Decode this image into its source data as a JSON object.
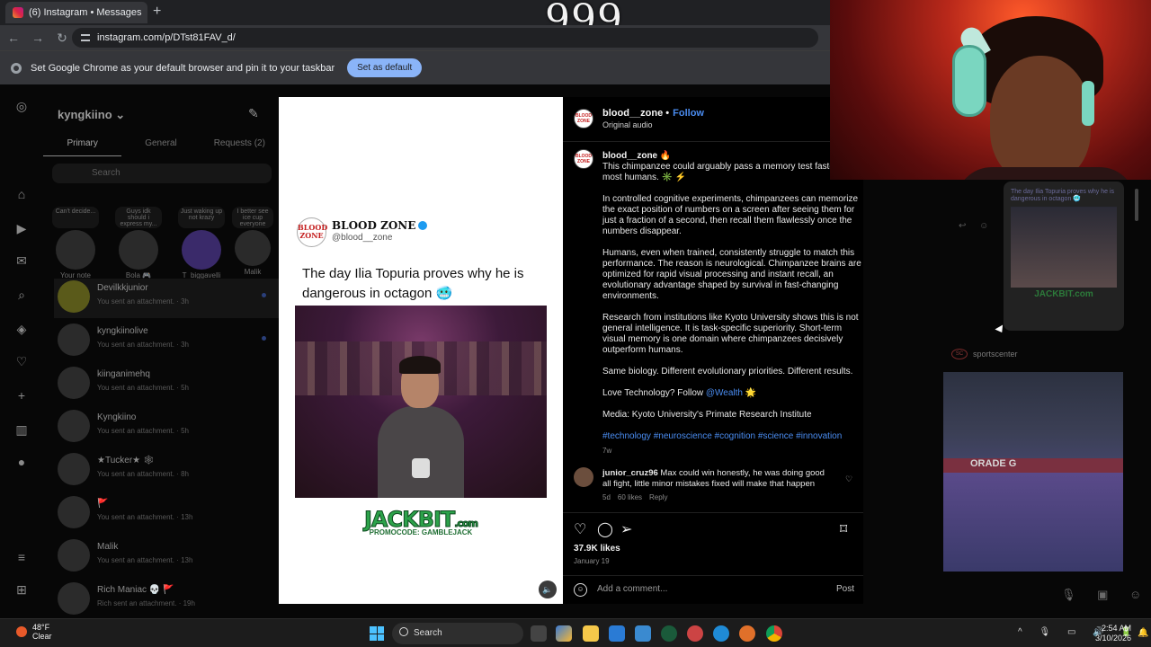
{
  "browser": {
    "tab_title": "(6) Instagram • Messages",
    "new_tab_icon": "+",
    "url": "instagram.com/p/DTst81FAV_d/",
    "overlay_text": "999",
    "infobar_text": "Set Google Chrome as your default browser and pin it to your taskbar",
    "infobar_button": "Set as default"
  },
  "inbox": {
    "username": "kyngkiino",
    "tabs": [
      "Primary",
      "General",
      "Requests (2)"
    ],
    "search_placeholder": "Search",
    "notes": [
      {
        "bubble": "Can't decide...",
        "name": "Your note"
      },
      {
        "bubble": "Guys idk should i express my...",
        "name": "Bola 🎮"
      },
      {
        "bubble": "Just waking up not krazy",
        "name": "T_biggavelli"
      },
      {
        "bubble": "I better see ice cup everyone",
        "name": "Malik"
      }
    ],
    "conversations": [
      {
        "name": "Devilkkjunior",
        "sub": "You sent an attachment. · 3h"
      },
      {
        "name": "kyngkiinolive",
        "sub": "You sent an attachment. · 3h"
      },
      {
        "name": "kiinganimehq",
        "sub": "You sent an attachment. · 5h"
      },
      {
        "name": "Kyngkiino",
        "sub": "You sent an attachment. · 5h"
      },
      {
        "name": "★Tucker★ 🕸",
        "sub": "You sent an attachment. · 8h"
      },
      {
        "name": "🚩",
        "sub": "You sent an attachment. · 13h"
      },
      {
        "name": "Malik",
        "sub": "You sent an attachment. · 13h"
      },
      {
        "name": "Rich Maniac 💀 🚩",
        "sub": "Rich sent an attachment. · 19h"
      }
    ]
  },
  "post": {
    "media": {
      "logo_text": "BLOOD ZONE",
      "account_name": "BLOOD ZONE",
      "account_handle": "@blood__zone",
      "headline": "The day Ilia Topuria proves why he is dangerous in octagon 🥶",
      "sponsor_brand": "JACKBIT",
      "sponsor_tld": ".com",
      "sponsor_promo": "PROMOCODE: GAMBLEJACK"
    },
    "author": "blood__zone",
    "follow_label": "Follow",
    "audio": "Original audio",
    "caption_author": "blood__zone 🔥",
    "caption_paragraphs": [
      "This chimpanzee could arguably pass a memory test faster than most humans. ✳️ ⚡",
      "In controlled cognitive experiments, chimpanzees can memorize the exact position of numbers on a screen after seeing them for just a fraction of a second, then recall them flawlessly once the numbers disappear.",
      "Humans, even when trained, consistently struggle to match this performance. The reason is neurological. Chimpanzee brains are optimized for rapid visual processing and instant recall, an evolutionary advantage shaped by survival in fast-changing environments.",
      "Research from institutions like Kyoto University shows this is not general intelligence. It is task-specific superiority. Short-term visual memory is one domain where chimpanzees decisively outperform humans.",
      "Same biology. Different evolutionary priorities. Different results."
    ],
    "love_text": "Love Technology? Follow",
    "love_link": "@Wealth",
    "love_emoji": "🌟",
    "media_credit": "Media: Kyoto University's Primate Research Institute",
    "hashtags": "#technology #neuroscience #cognition #science #innovation",
    "age": "7w",
    "comment": {
      "user": "junior_cruz96",
      "text": "Max could win honestly, he was doing good all fight, little minor mistakes fixed will make that happen",
      "age": "5d",
      "likes": "60 likes",
      "reply": "Reply"
    },
    "likes": "37.9K likes",
    "date": "January 19",
    "comment_placeholder": "Add a comment...",
    "post_button": "Post"
  },
  "right_panel": {
    "thumb_title": "The day Ilia Topuria proves why he is dangerous in octagon 🥶",
    "thumb_sponsor": "JACKBIT.com",
    "account": "sportscenter",
    "court_banner": "ORADE G"
  },
  "taskbar": {
    "temp": "48°F",
    "condition": "Clear",
    "search": "Search",
    "time": "2:54 AM",
    "date": "3/10/2026"
  }
}
